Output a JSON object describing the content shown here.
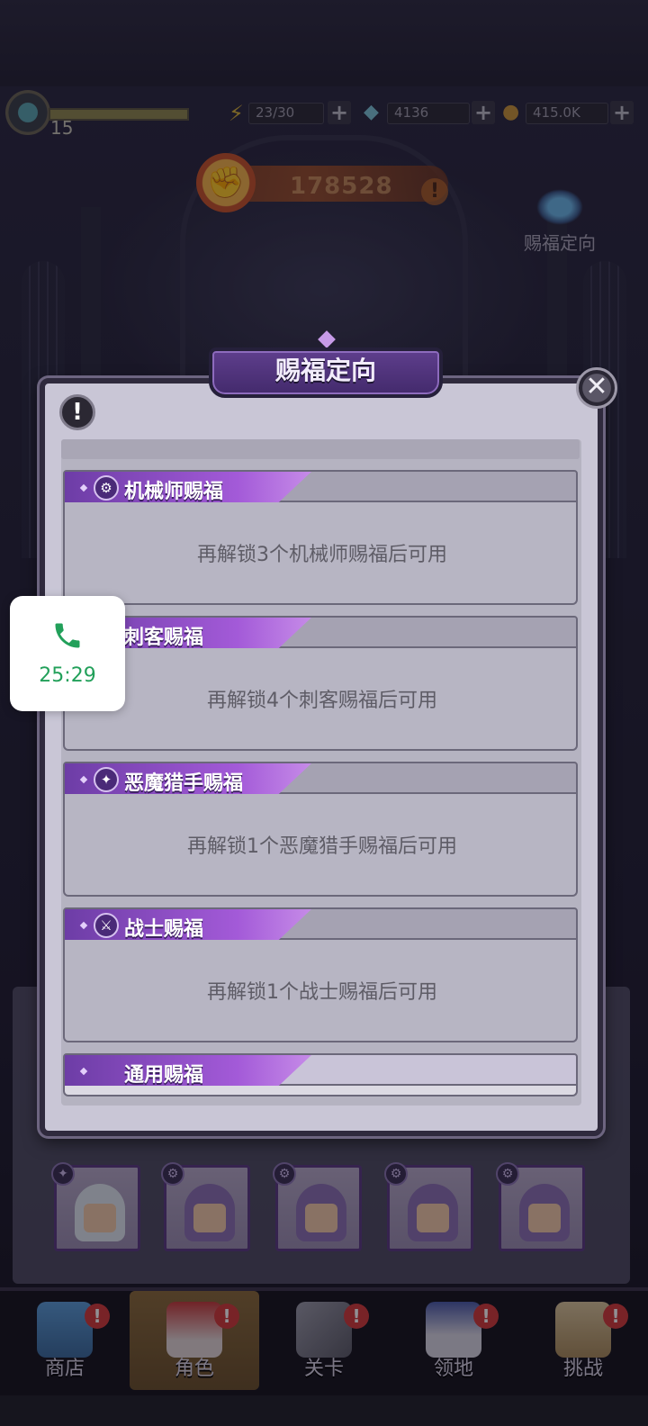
{
  "hud": {
    "level": "15",
    "exp_progress": 1.0,
    "stamina": "23/30",
    "gems": "4136",
    "gold": "415.0K"
  },
  "power": {
    "value": "178528",
    "fist_icon": "fist-icon",
    "alert": "!"
  },
  "fate_shortcut": {
    "label": "赐福定向"
  },
  "dialog": {
    "title": "赐福定向",
    "close_symbol": "✕",
    "info_symbol": "!",
    "sections": [
      {
        "title": "机械师赐福",
        "icon": "gear-icon",
        "glyph": "⚙",
        "message": "再解锁3个机械师赐福后可用"
      },
      {
        "title": "刺客赐福",
        "icon": "dagger-icon",
        "glyph": "⚔",
        "message": "再解锁4个刺客赐福后可用"
      },
      {
        "title": "恶魔猎手赐福",
        "icon": "hunter-icon",
        "glyph": "✦",
        "message": "再解锁1个恶魔猎手赐福后可用"
      },
      {
        "title": "战士赐福",
        "icon": "sword-icon",
        "glyph": "⚔",
        "message": "再解锁1个战士赐福后可用"
      },
      {
        "title": "通用赐福",
        "icon": "sparkle-icon",
        "message": ""
      }
    ]
  },
  "call": {
    "time": "25:29",
    "icon": "phone-icon"
  },
  "nav": {
    "items": [
      {
        "label": "商店",
        "icon": "shop-icon",
        "alert": "!"
      },
      {
        "label": "角色",
        "icon": "character-icon",
        "alert": "!"
      },
      {
        "label": "关卡",
        "icon": "crossed-swords-icon",
        "alert": "!"
      },
      {
        "label": "领地",
        "icon": "castle-icon",
        "alert": "!"
      },
      {
        "label": "挑战",
        "icon": "scroll-map-icon",
        "alert": "!"
      }
    ],
    "active_index": 1
  },
  "colors": {
    "accent_purple": "#a35ad8",
    "power_orange": "#c45e25",
    "call_green": "#22a05a"
  }
}
